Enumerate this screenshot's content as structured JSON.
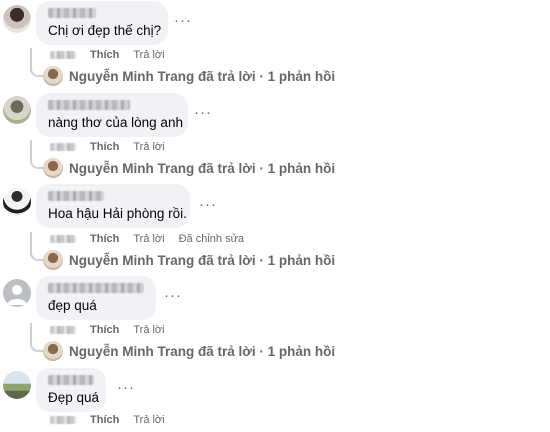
{
  "comments": [
    {
      "text": "Chị ơi đẹp thế chị?",
      "actions": {
        "like": "Thích",
        "reply": "Trả lời",
        "edited": ""
      },
      "reply_summary": {
        "name": "Nguyễn Minh Trang",
        "text": "đã trả lời · 1 phản hồi"
      },
      "more_icon": "more-horizontal-icon"
    },
    {
      "text": "nàng thơ của lòng anh",
      "actions": {
        "like": "Thích",
        "reply": "Trả lời",
        "edited": ""
      },
      "reply_summary": {
        "name": "Nguyễn Minh Trang",
        "text": "đã trả lời · 1 phản hồi"
      },
      "more_icon": "more-horizontal-icon"
    },
    {
      "text": "Hoa hậu Hải phòng rồi.",
      "actions": {
        "like": "Thích",
        "reply": "Trả lời",
        "edited": "Đã chỉnh sửa"
      },
      "reply_summary": {
        "name": "Nguyễn Minh Trang",
        "text": "đã trả lời · 1 phản hồi"
      },
      "more_icon": "more-horizontal-icon"
    },
    {
      "text": "đẹp quá",
      "actions": {
        "like": "Thích",
        "reply": "Trả lời",
        "edited": ""
      },
      "reply_summary": {
        "name": "Nguyễn Minh Trang",
        "text": "đã trả lời · 1 phản hồi"
      },
      "more_icon": "more-horizontal-icon"
    },
    {
      "text": "Đẹp quá",
      "actions": {
        "like": "Thích",
        "reply": "Trả lời",
        "edited": ""
      },
      "more_icon": "more-horizontal-icon"
    }
  ],
  "colors": {
    "bubble": "#f0f2f5",
    "secondary_text": "#65676b",
    "connector": "#ced0d4"
  }
}
